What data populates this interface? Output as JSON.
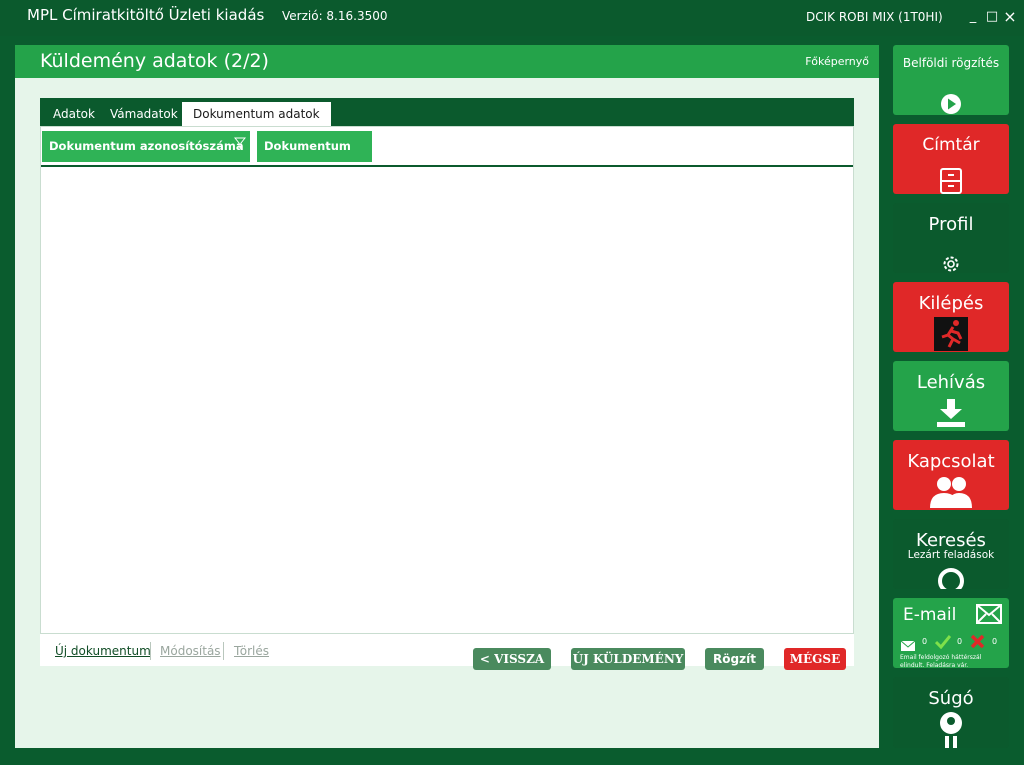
{
  "window": {
    "title": "MPL Címiratkitöltő Üzleti kiadás",
    "version": "Verzió: 8.16.3500",
    "user": "DCIK ROBI MIX (1T0HI)",
    "minimize": "_",
    "maximize": "□",
    "close": "×"
  },
  "panel": {
    "title": "Küldemény adatok (2/2)",
    "home_link": "Főképernyő"
  },
  "tabs": [
    {
      "label": "Adatok",
      "active": false
    },
    {
      "label": "Vámadatok",
      "active": false
    },
    {
      "label": "Dokumentum adatok",
      "active": true
    }
  ],
  "grid": {
    "columns": [
      "Dokumentum azonosítószáma",
      "Dokumentum név"
    ],
    "rows": []
  },
  "grid_actions": {
    "new": "Új dokumentum",
    "edit": "Módosítás",
    "delete": "Törlés"
  },
  "buttons": {
    "back": "< VISSZA",
    "new_shipment": "ÚJ KÜLDEMÉNY",
    "save": "Rögzít",
    "cancel": "MÉGSE"
  },
  "side_tiles": {
    "domestic": "Belföldi rögzítés",
    "directory": "Címtár",
    "profile": "Profil",
    "logout": "Kilépés",
    "pickup": "Lehívás",
    "contact": "Kapcsolat",
    "search": "Keresés",
    "search_sub": "Lezárt feladások",
    "email": "E-mail",
    "email_counts": [
      "0",
      "0",
      "0"
    ],
    "email_note": "Email feldolgozó háttérszál elindult. Feladásra vár.",
    "help": "Súgó"
  },
  "colors": {
    "dark_green": "#0b5a2d",
    "green": "#24a34a",
    "red": "#e02828",
    "panel_bg": "#e6f5ea"
  }
}
